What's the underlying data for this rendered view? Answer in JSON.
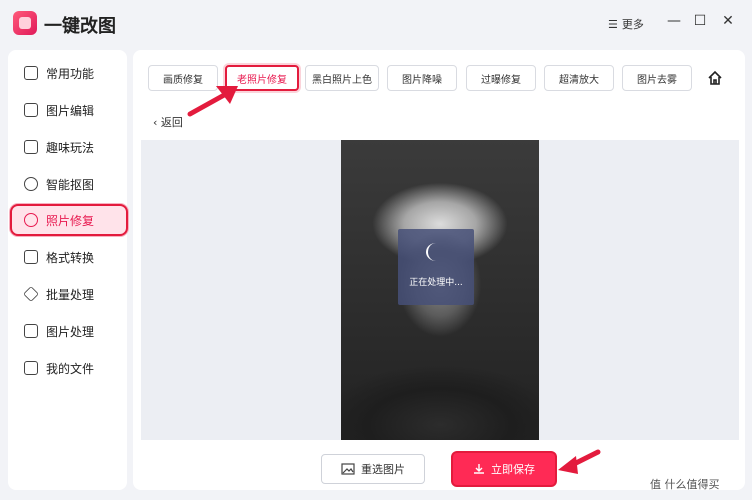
{
  "app": {
    "title": "一键改图"
  },
  "window": {
    "more_label": "更多",
    "more_icon": "menu-icon",
    "minimize": "—",
    "maximize": "☐",
    "close": "✕"
  },
  "sidebar": {
    "items": [
      {
        "label": "常用功能",
        "icon": "grid-icon"
      },
      {
        "label": "图片编辑",
        "icon": "edit-icon"
      },
      {
        "label": "趣味玩法",
        "icon": "magic-icon"
      },
      {
        "label": "智能抠图",
        "icon": "target-icon"
      },
      {
        "label": "照片修复",
        "icon": "repair-icon",
        "active": true
      },
      {
        "label": "格式转换",
        "icon": "convert-icon"
      },
      {
        "label": "批量处理",
        "icon": "layers-icon"
      },
      {
        "label": "图片处理",
        "icon": "image-icon"
      },
      {
        "label": "我的文件",
        "icon": "file-icon"
      }
    ]
  },
  "tabs": [
    {
      "label": "画质修复"
    },
    {
      "label": "老照片修复",
      "active": true
    },
    {
      "label": "黑白照片上色"
    },
    {
      "label": "图片降噪"
    },
    {
      "label": "过曝修复"
    },
    {
      "label": "超清放大"
    },
    {
      "label": "图片去雾"
    }
  ],
  "back_label": "返回",
  "processing": {
    "spinner": "(",
    "text": "正在处理中..."
  },
  "buttons": {
    "reselect": "重选图片",
    "save": "立即保存"
  },
  "watermark": "值 什么值得买",
  "colors": {
    "accent": "#ff2a55",
    "highlight_border": "#e31b3d"
  }
}
